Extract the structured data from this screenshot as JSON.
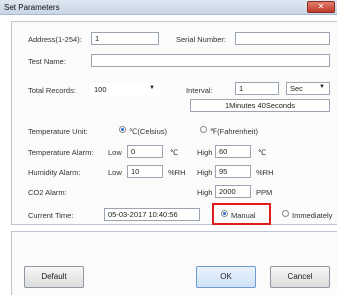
{
  "window": {
    "title": "Set Parameters",
    "close_label": "✕"
  },
  "form": {
    "address_label": "Address(1-254):",
    "address_value": "1",
    "serial_label": "Serial Number:",
    "serial_value": "",
    "test_name_label": "Test Name:",
    "test_name_value": "",
    "total_records_label": "Total Records:",
    "total_records_value": "100",
    "interval_label": "Interval:",
    "interval_value": "1",
    "interval_unit": "Sec",
    "interval_readout": "1Minutes 40Seconds",
    "temp_unit_label": "Temperature Unit:",
    "temp_unit_options": [
      "℃(Celsius)",
      "℉(Fahrenheit)"
    ],
    "temp_unit_selected": "℃(Celsius)",
    "temp_alarm_label": "Temperature Alarm:",
    "humidity_alarm_label": "Humidity Alarm:",
    "co2_alarm_label": "CO2 Alarm:",
    "low_label": "Low",
    "high_label": "High",
    "temp_low": "0",
    "temp_high": "60",
    "temp_unit_symbol": "℃",
    "hum_low": "10",
    "hum_high": "95",
    "hum_unit": "%RH",
    "co2_high": "2000",
    "co2_unit": "PPM",
    "current_time_label": "Current Time:",
    "current_time_value": "05-03-2017 10:40:56",
    "time_options": [
      "Manual",
      "Immediately"
    ],
    "time_selected": "Manual"
  },
  "buttons": {
    "default": "Default",
    "ok": "OK",
    "cancel": "Cancel"
  },
  "arrow": "▼"
}
